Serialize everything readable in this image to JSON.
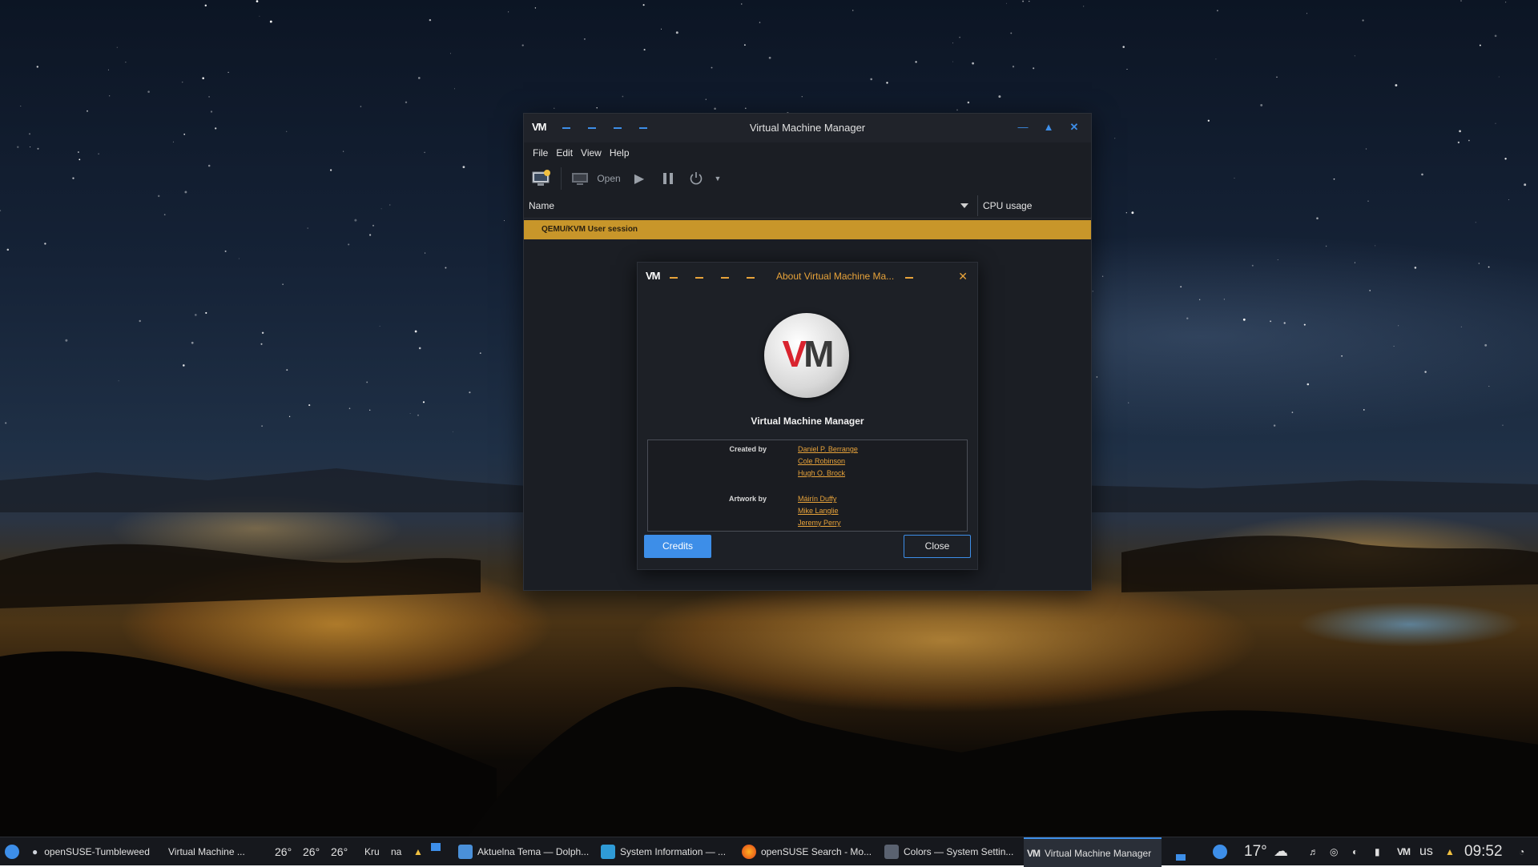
{
  "main_window": {
    "title": "Virtual Machine Manager",
    "logo": "VM",
    "menu": [
      "File",
      "Edit",
      "View",
      "Help"
    ],
    "toolbar": {
      "open_label": "Open"
    },
    "columns": {
      "name": "Name",
      "cpu": "CPU usage"
    },
    "session_row": "QEMU/KVM User session",
    "accent_color": "#3d8ee8",
    "selection_color": "#c8962a"
  },
  "about_dialog": {
    "title": "About Virtual Machine Ma...",
    "logo": "VM",
    "app_name": "Virtual Machine Manager",
    "created_by_label": "Created by",
    "created_by": [
      "Daniel P. Berrange",
      "Cole Robinson",
      "Hugh O. Brock"
    ],
    "artwork_by_label": "Artwork by",
    "artwork_by": [
      "Máirín Duffy",
      "Mike Langlie",
      "Jeremy Perry"
    ],
    "credits_button": "Credits",
    "close_button": "Close",
    "accent_color": "#e8a33a"
  },
  "taskbar": {
    "items": [
      "openSUSE-Tumbleweed",
      "Virtual Machine ...",
      "26°",
      "26°",
      "26°",
      "Kru",
      "na",
      "Aktuelna Tema — Dolph...",
      "System Information — ...",
      "openSUSE Search - Mo...",
      "Colors — System Settin...",
      "Virtual Machine Manager"
    ],
    "weather_temp": "17°",
    "keyboard_layout": "us",
    "clock": "09:52",
    "icons": [
      "opensuse-icon",
      "cloud-icon",
      "folder-icon",
      "info-icon",
      "firefox-icon",
      "settings-icon",
      "virt-manager-icon",
      "bell-icon",
      "network-icon",
      "volume-icon"
    ]
  }
}
